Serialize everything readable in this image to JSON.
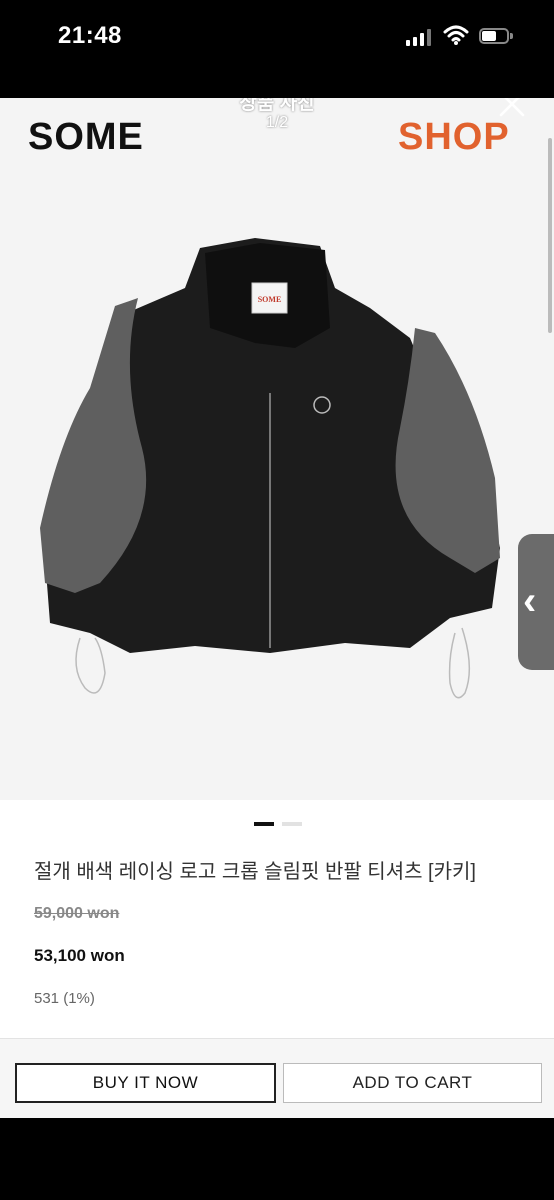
{
  "status_bar": {
    "time": "21:48"
  },
  "viewer": {
    "title": "상품 사진",
    "counter": "1/2",
    "brand_left": "SOME",
    "brand_right": "SHOP",
    "brand_right_color": "#e1622e",
    "label_text": "SOME",
    "close_icon": "close-icon",
    "side_handle_icon": "chevron-left-icon"
  },
  "product": {
    "name": "절개 배색 레이싱 로고 크롭 슬림핏 반팔 티셔츠 [카키]",
    "original_price": "59,000 won",
    "sale_price": "53,100 won",
    "points": "531 (1%)"
  },
  "actions": {
    "buy_now": "BUY IT NOW",
    "add_to_cart": "ADD TO CART"
  }
}
